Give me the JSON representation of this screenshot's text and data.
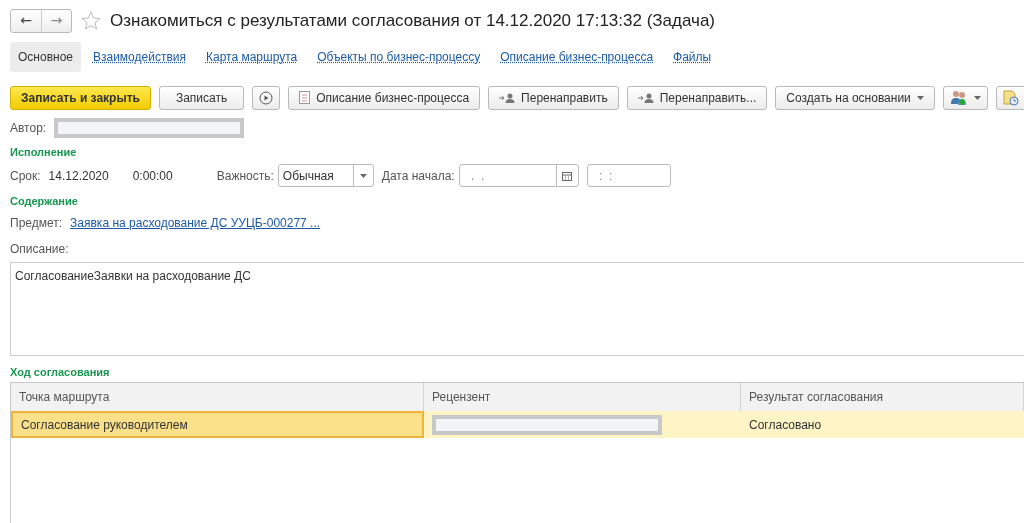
{
  "window": {
    "title": "Ознакомиться с результатами согласования от 14.12.2020 17:13:32 (Задача)",
    "back": "←",
    "forward": "→",
    "favorite": false
  },
  "tabs": [
    {
      "label": "Основное",
      "selected": true
    },
    {
      "label": "Взаимодействия",
      "selected": false
    },
    {
      "label": "Карта маршрута",
      "selected": false
    },
    {
      "label": "Объекты по бизнес-процессу",
      "selected": false
    },
    {
      "label": "Описание бизнес-процесса",
      "selected": false
    },
    {
      "label": "Файлы",
      "selected": false
    }
  ],
  "toolbar": [
    {
      "kind": "primary",
      "label": "Записать и закрыть"
    },
    {
      "kind": "plain",
      "label": "Записать"
    },
    {
      "kind": "run"
    },
    {
      "kind": "document",
      "label": "Описание бизнес-процесса"
    },
    {
      "kind": "redirect",
      "label": "Перенаправить"
    },
    {
      "kind": "redirect",
      "label": "Перенаправить..."
    },
    {
      "kind": "dropdown",
      "label": "Создать на основании"
    },
    {
      "kind": "people"
    },
    {
      "kind": "report"
    }
  ],
  "author": {
    "label": "Автор:"
  },
  "execution": {
    "heading": "Исполнение",
    "due_label": "Срок:",
    "due_date": "14.12.2020",
    "due_time": "0:00:00",
    "importance_label": "Важность:",
    "importance": "Обычная",
    "start_label": "Дата начала:",
    "start_date": " .  .",
    "start_time": " :  :"
  },
  "content": {
    "heading": "Содержание",
    "subject_label": "Предмет:",
    "subject": "Заявка на расходование ДС УУЦБ-000277 ...",
    "description_label": "Описание:",
    "description": "СогласованиеЗаявки на расходование ДС"
  },
  "approval": {
    "heading": "Ход согласования",
    "columns": [
      "Точка маршрута",
      "Рецензент",
      "Результат согласования"
    ],
    "rows": [
      {
        "route_point": "Согласование руководителем",
        "result": "Согласовано",
        "selected": true
      }
    ]
  }
}
